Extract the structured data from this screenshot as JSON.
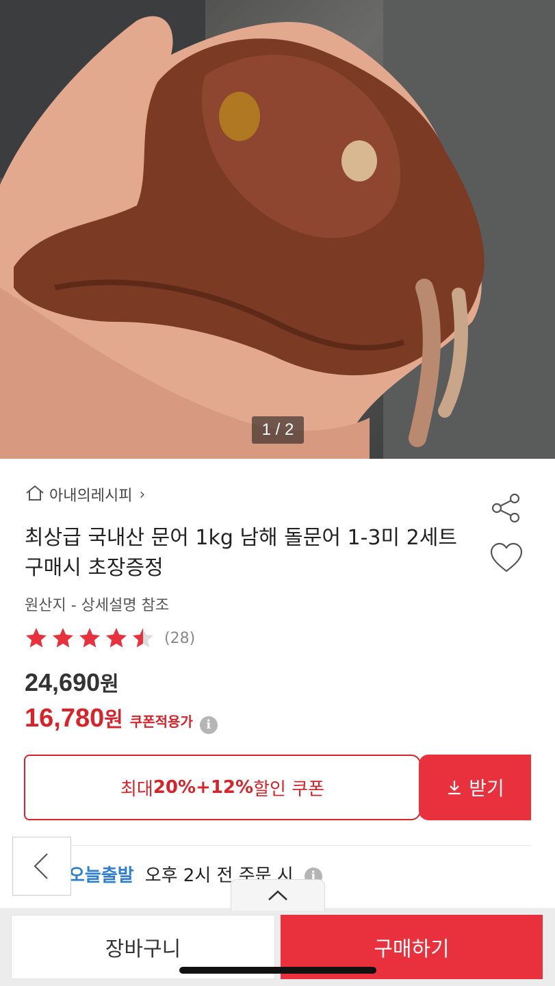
{
  "gallery": {
    "counter": "1 / 2",
    "photo_icon": "octopus-photo"
  },
  "store": {
    "icon": "home-icon",
    "name": "아내의레시피",
    "chevron": "›"
  },
  "product": {
    "title": "최상급 국내산 문어 1kg 남해 돌문어 1-3미 2세트 구매시 초장증정",
    "origin": "원산지 - 상세설명 참조",
    "rating": 4.5,
    "rating_count": "(28)",
    "price_original": "24,690",
    "price_original_unit": "원",
    "price_sale": "16,780",
    "price_sale_unit": "원",
    "price_sale_label": "쿠폰적용가",
    "info_glyph": "i"
  },
  "actions": {
    "share_icon": "share-icon",
    "wishlist_icon": "heart-icon"
  },
  "coupon": {
    "prefix": "최대 ",
    "highlight": "20%+12%",
    "suffix": " 할인 쿠폰",
    "download_label": "받기",
    "download_icon": "download-icon"
  },
  "delivery": {
    "tag": "오늘출발",
    "desc": "오후 2시 전 주문 시"
  },
  "bottom_bar": {
    "cart_label": "장바구니",
    "buy_label": "구매하기",
    "expand_icon": "chevron-up-icon",
    "back_icon": "chevron-left-icon"
  },
  "colors": {
    "accent_red": "#e8313d",
    "price_red": "#d8232a",
    "delivery_blue": "#2f7fd1",
    "star_red": "#e8313d"
  }
}
